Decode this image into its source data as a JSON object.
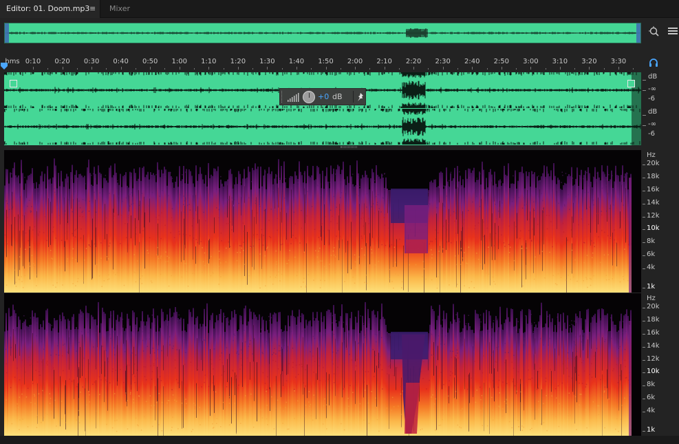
{
  "tabs": {
    "editor_label": "Editor: 01. Doom.mp3",
    "editor_menu": "≡",
    "mixer_label": "Mixer"
  },
  "ruler": {
    "start_label": "hms",
    "labels": [
      "0:10",
      "0:20",
      "0:30",
      "0:40",
      "0:50",
      "1:00",
      "1:10",
      "1:20",
      "1:30",
      "1:40",
      "1:50",
      "2:00",
      "2:10",
      "2:20",
      "2:30",
      "2:40",
      "2:50",
      "3:00",
      "3:10",
      "3:20",
      "3:30"
    ]
  },
  "gain_hud": {
    "value": "+0",
    "unit": "dB"
  },
  "amplitude_scale": {
    "top": [
      "dB",
      "-∞",
      "-6"
    ],
    "bottom": [
      "dB",
      "-∞",
      "-6"
    ]
  },
  "frequency_scale": {
    "unit": "Hz",
    "labels": [
      "20k",
      "18k",
      "16k",
      "14k",
      "12k",
      "10k",
      "8k",
      "6k",
      "4k",
      "1k"
    ]
  },
  "colors": {
    "waveform": "#45d796",
    "accent": "#4aa6ff",
    "spectrum_low": "#fce36e",
    "spectrum_mid": "#e8231e",
    "spectrum_high": "#5a1f7a"
  },
  "icons": {
    "zoom": "zoom-icon",
    "list": "list-icon",
    "headphones": "headphones-icon",
    "pin": "pin-icon"
  }
}
